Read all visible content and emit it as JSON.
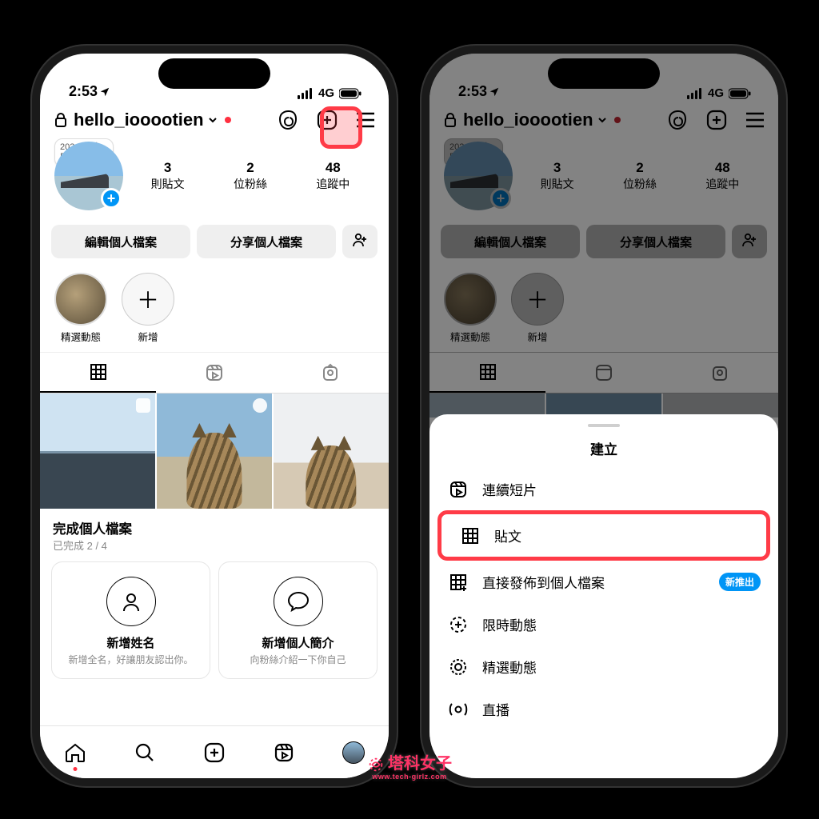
{
  "status_bar": {
    "time": "2:53",
    "network": "4G"
  },
  "profile": {
    "username": "hello_iooootien",
    "note_bubble": "2024 年熱門金曲？",
    "stats": [
      {
        "num": "3",
        "label": "則貼文"
      },
      {
        "num": "2",
        "label": "位粉絲"
      },
      {
        "num": "48",
        "label": "追蹤中"
      }
    ],
    "buttons": {
      "edit": "編輯個人檔案",
      "share": "分享個人檔案"
    },
    "highlights": [
      {
        "label": "精選動態"
      },
      {
        "label": "新增"
      }
    ],
    "complete": {
      "title": "完成個人檔案",
      "progress": "已完成 2 / 4",
      "cards": [
        {
          "title": "新增姓名",
          "desc": "新增全名，好讓朋友認出你。"
        },
        {
          "title": "新增個人簡介",
          "desc": "向粉絲介紹一下你自己"
        }
      ]
    }
  },
  "sheet": {
    "title": "建立",
    "items": [
      {
        "icon": "reels",
        "label": "連續短片",
        "highlight": false
      },
      {
        "icon": "grid",
        "label": "貼文",
        "highlight": true
      },
      {
        "icon": "gridplus",
        "label": "直接發佈到個人檔案",
        "badge": "新推出"
      },
      {
        "icon": "story",
        "label": "限時動態"
      },
      {
        "icon": "star",
        "label": "精選動態"
      },
      {
        "icon": "live",
        "label": "直播"
      }
    ]
  },
  "watermark": {
    "main": "塔科女子",
    "sub": "www.tech-girlz.com"
  }
}
